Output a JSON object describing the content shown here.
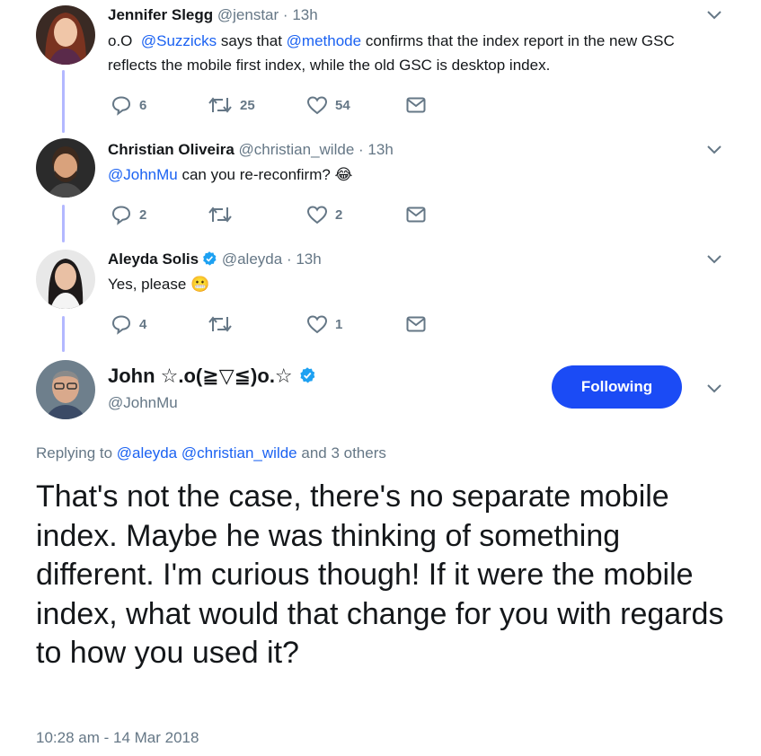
{
  "tweets": [
    {
      "name": "Jennifer Slegg",
      "handle": "@jenstar",
      "dot": "·",
      "time": "13h",
      "text_prefix": "o.O  ",
      "mention1": "@Suzzicks",
      "text_mid": " says that ",
      "mention2": "@methode",
      "text_suffix": " confirms that the index report in the new GSC reflects the mobile first index, while the old GSC is desktop index.",
      "replies": "6",
      "retweets": "25",
      "likes": "54"
    },
    {
      "name": "Christian Oliveira",
      "handle": "@christian_wilde",
      "dot": "·",
      "time": "13h",
      "mention": "@JohnMu",
      "text": " can you re-reconfirm? ",
      "emoji": "😂",
      "replies": "2",
      "likes": "2"
    },
    {
      "name": "Aleyda Solis",
      "handle": "@aleyda",
      "dot": "·",
      "time": "13h",
      "text": "Yes, please ",
      "emoji": "😬",
      "replies": "4",
      "likes": "1"
    }
  ],
  "main": {
    "name": "John ☆.o(≧▽≦)o.☆",
    "handle": "@JohnMu",
    "follow_label": "Following",
    "replying_prefix": "Replying to ",
    "replying_mention1": "@aleyda",
    "replying_mention2": "@christian_wilde",
    "replying_suffix": " and 3 others",
    "text": "That's not the case, there's no separate mobile index. Maybe he was thinking of something different. I'm curious though! If it were the mobile index, what would that change for you with regards to how you used it?",
    "timestamp": "10:28 am - 14 Mar 2018"
  },
  "colors": {
    "accent": "#1b4bf5",
    "link": "#1b62f2",
    "muted": "#657786",
    "thread_line": "#b3b8ff",
    "verified": "#1da1f2"
  },
  "icons": [
    "reply-icon",
    "retweet-icon",
    "like-icon",
    "dm-icon",
    "chevron-down-icon",
    "verified-badge-icon"
  ]
}
